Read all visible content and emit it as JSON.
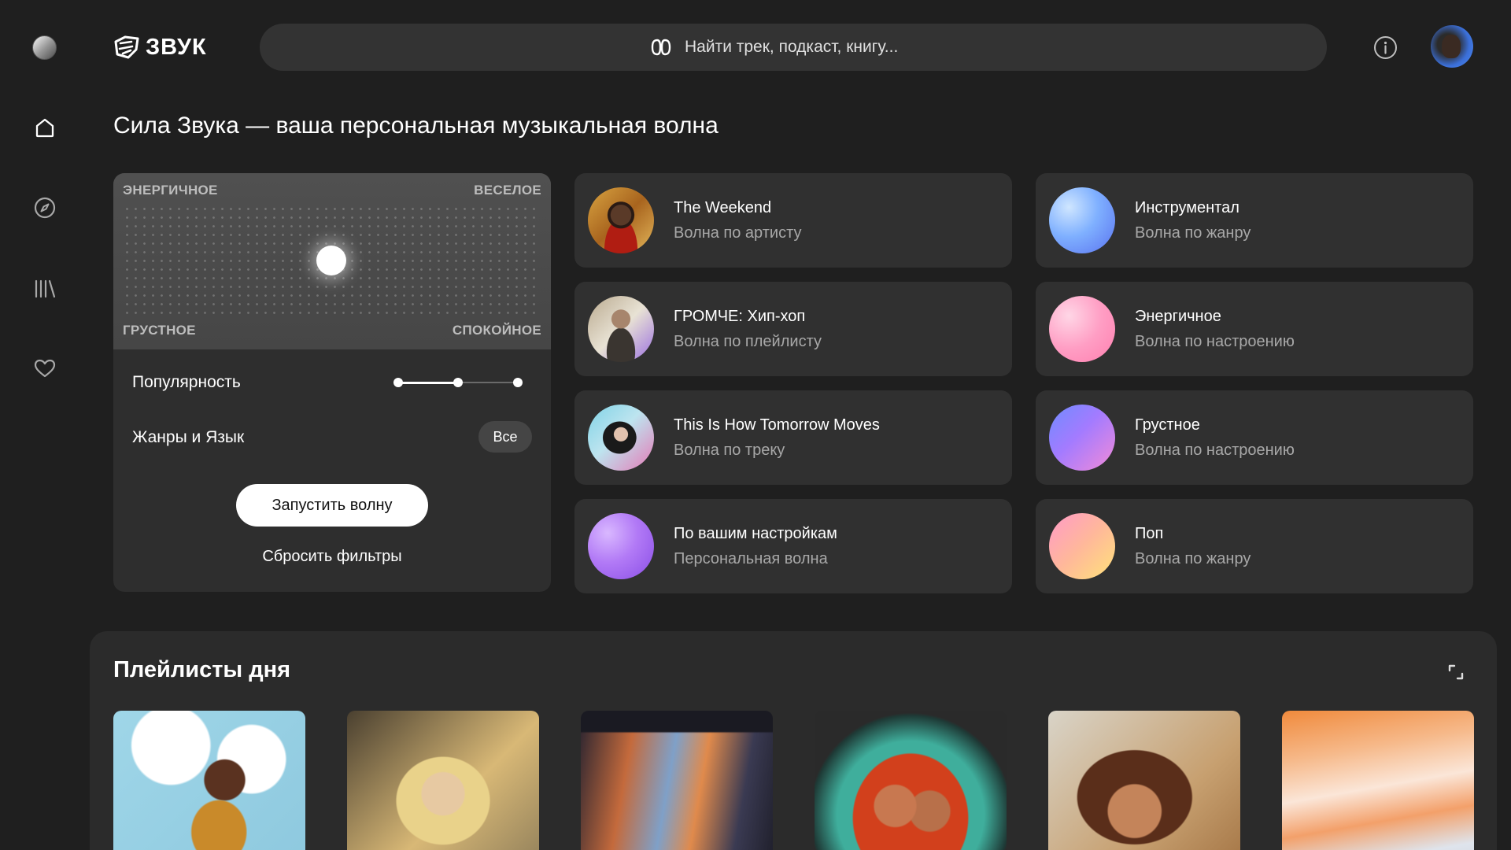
{
  "header": {
    "logo_text": "ЗВУК",
    "search_placeholder": "Найти трек, подкаст, книгу..."
  },
  "headline": "Сила Звука — ваша персональная музыкальная волна",
  "mood": {
    "top_left": "ЭНЕРГИЧНОЕ",
    "top_right": "ВЕСЕЛОЕ",
    "bottom_left": "ГРУСТНОЕ",
    "bottom_right": "СПОКОЙНОЕ",
    "popularity_label": "Популярность",
    "popularity_level": 0.5,
    "genres_label": "Жанры и Язык",
    "genres_value": "Все",
    "start_button": "Запустить волну",
    "reset_link": "Сбросить фильтры"
  },
  "waves_left": [
    {
      "title": "The Weekend",
      "subtitle": "Волна по артисту"
    },
    {
      "title": "ГРОМЧЕ: Хип-хоп",
      "subtitle": "Волна по плейлисту"
    },
    {
      "title": "This Is How Tomorrow Moves",
      "subtitle": "Волна по треку"
    },
    {
      "title": "По вашим настройкам",
      "subtitle": "Персональная волна"
    }
  ],
  "waves_right": [
    {
      "title": "Инструментал",
      "subtitle": "Волна по жанру"
    },
    {
      "title": "Энергичное",
      "subtitle": "Волна по настроению"
    },
    {
      "title": "Грустное",
      "subtitle": "Волна по настроению"
    },
    {
      "title": "Поп",
      "subtitle": "Волна по жанру"
    }
  ],
  "playlists": {
    "title": "Плейлисты дня"
  }
}
